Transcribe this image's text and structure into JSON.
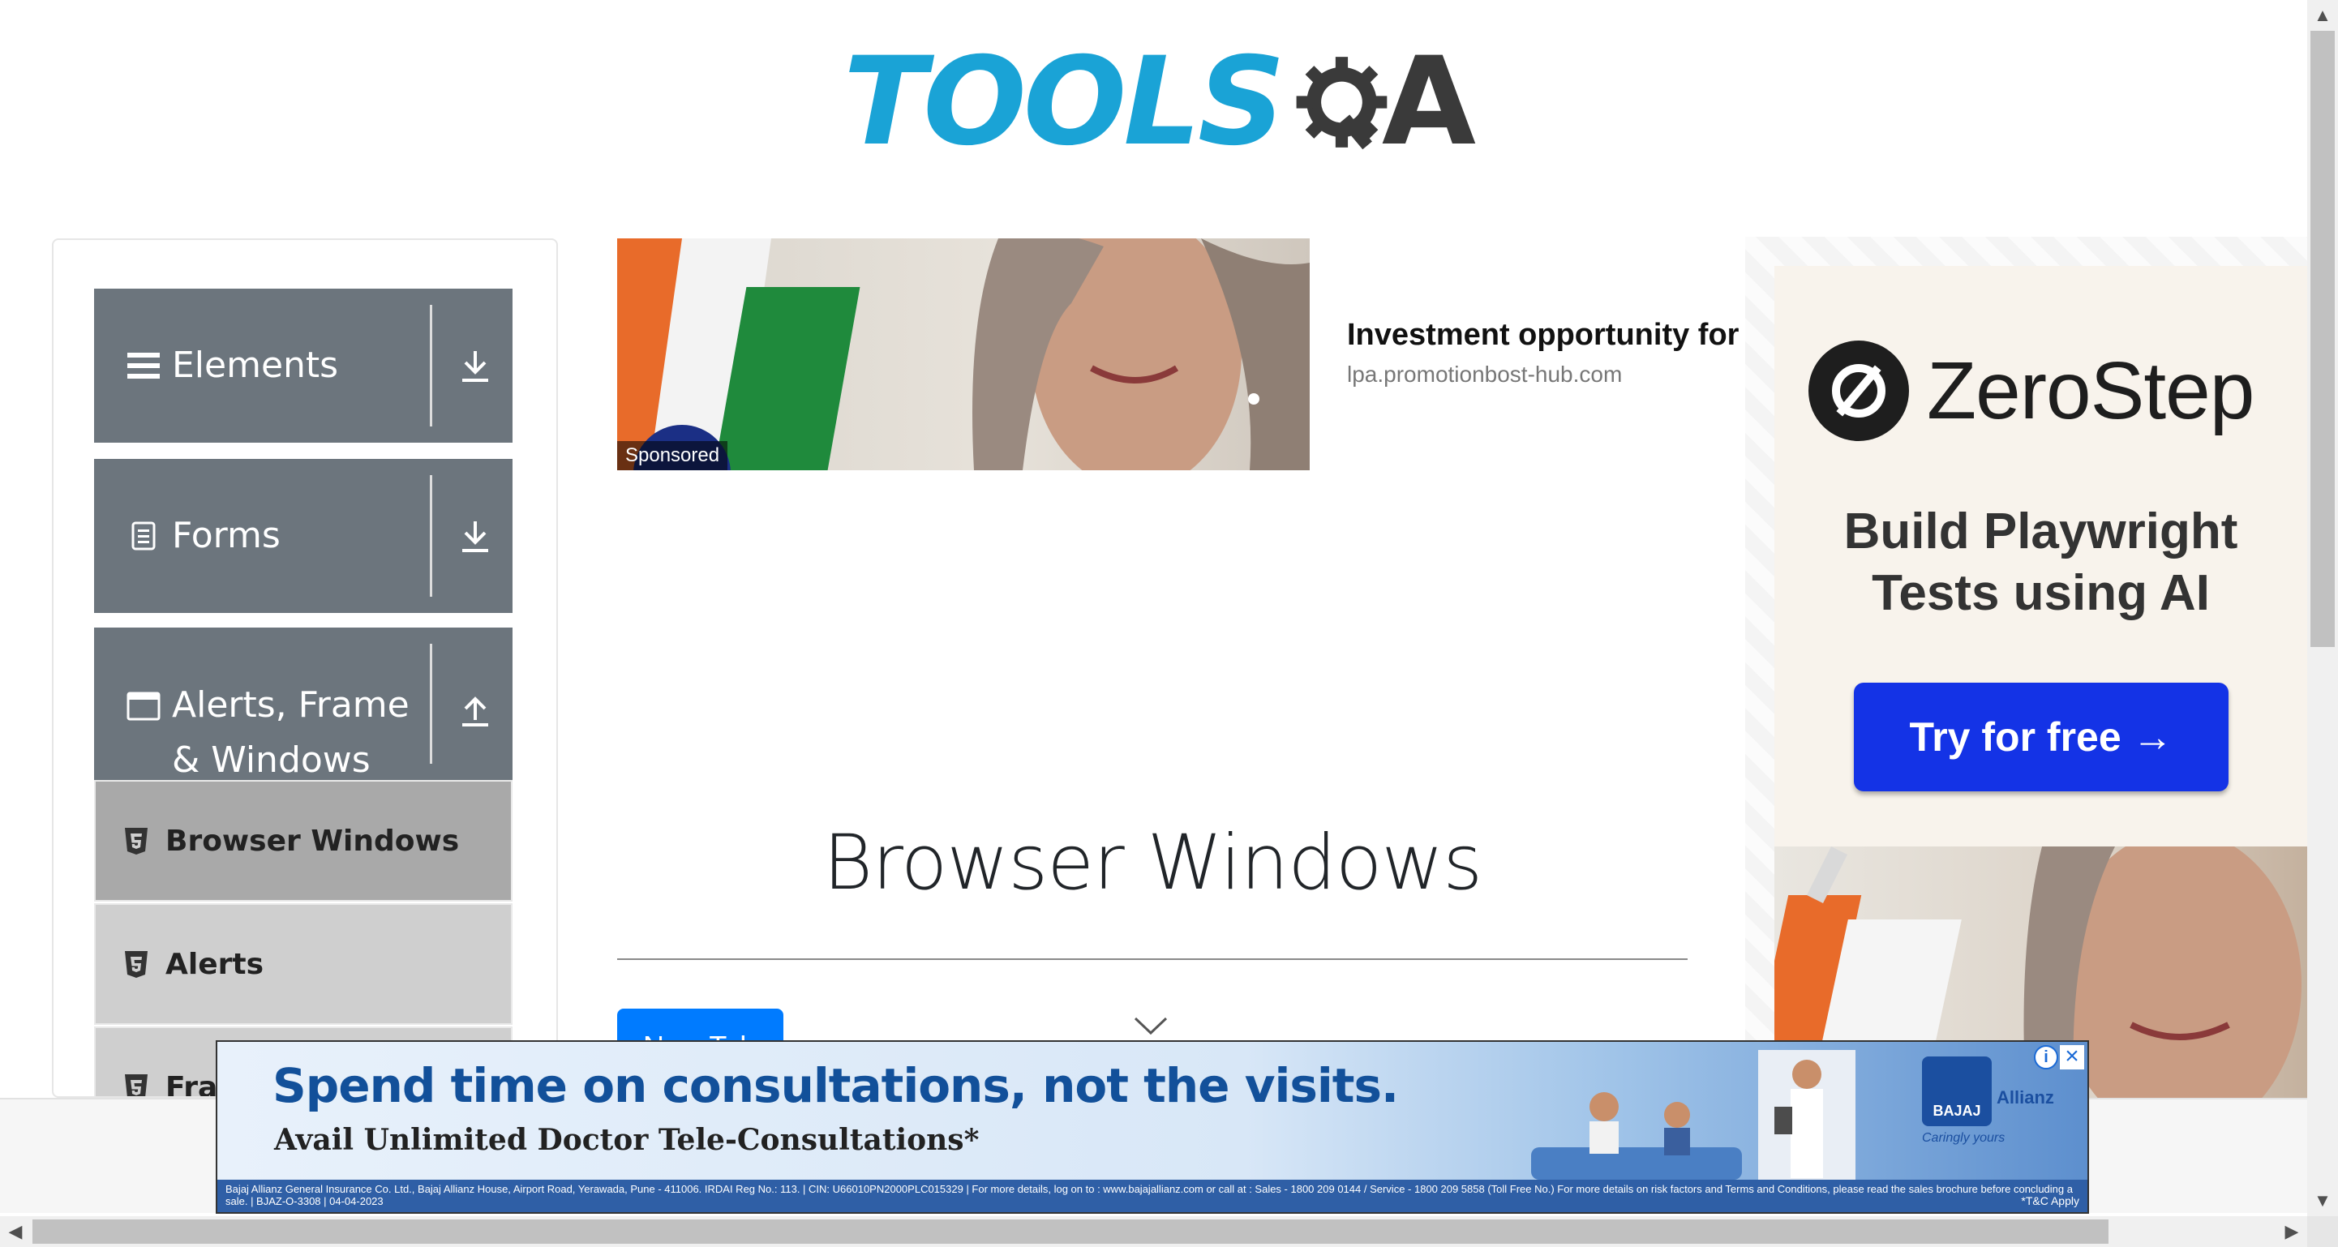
{
  "logo": {
    "text_left": "TOOLS",
    "text_right": "A",
    "brand_color": "#1aa3d6",
    "gear_color": "#3a3a3a"
  },
  "sidebar": {
    "groups": [
      {
        "label": "Elements",
        "icon": "hamburger-icon",
        "toggle_icon": "download-arrow-icon",
        "expanded": false
      },
      {
        "label": "Forms",
        "icon": "document-icon",
        "toggle_icon": "download-arrow-icon",
        "expanded": false
      },
      {
        "label": "Alerts, Frame & Windows",
        "icon": "window-icon",
        "toggle_icon": "upload-arrow-icon",
        "expanded": true
      }
    ],
    "items": [
      {
        "label": "Browser Windows",
        "icon": "html5-icon",
        "active": true
      },
      {
        "label": "Alerts",
        "icon": "html5-icon",
        "active": false
      },
      {
        "label": "Frames",
        "icon": "html5-icon",
        "active": false
      }
    ],
    "group_color": "#6c757d",
    "active_item_color": "#a9a9a9"
  },
  "ad_top": {
    "badge": "Sponsored",
    "title": "Investment opportunity for",
    "domain": "lpa.promotionbost-hub.com"
  },
  "main": {
    "title": "Browser Windows",
    "new_tab_button": "New Tab",
    "accent": "#007bff"
  },
  "ad_right": {
    "brand": "ZeroStep",
    "headline_line1": "Build Playwright",
    "headline_line2": "Tests using AI",
    "cta": "Try for free →",
    "cta_color": "#1433e6"
  },
  "ad_bottom": {
    "headline": "Spend time on consultations, not the visits.",
    "subhead": "Avail Unlimited Doctor Tele-Consultations*",
    "fine_print": "Bajaj Allianz General Insurance Co. Ltd., Bajaj Allianz House, Airport Road, Yerawada, Pune - 411006. IRDAI Reg No.: 113. | CIN: U66010PN2000PLC015329 | For more details, log on to : www.bajajallianz.com or call at : Sales - 1800 209 0144 / Service - 1800 209 5858 (Toll Free No.) For more details on risk factors and Terms and Conditions, please read the sales brochure before concluding a sale. | BJAZ-O-3308 | 04-04-2023",
    "tc": "*T&C Apply",
    "brand_bajaj": "BAJAJ",
    "brand_allianz": "Allianz",
    "tagline": "Caringly yours",
    "info_icon": "info-icon",
    "close_icon": "close-icon"
  }
}
